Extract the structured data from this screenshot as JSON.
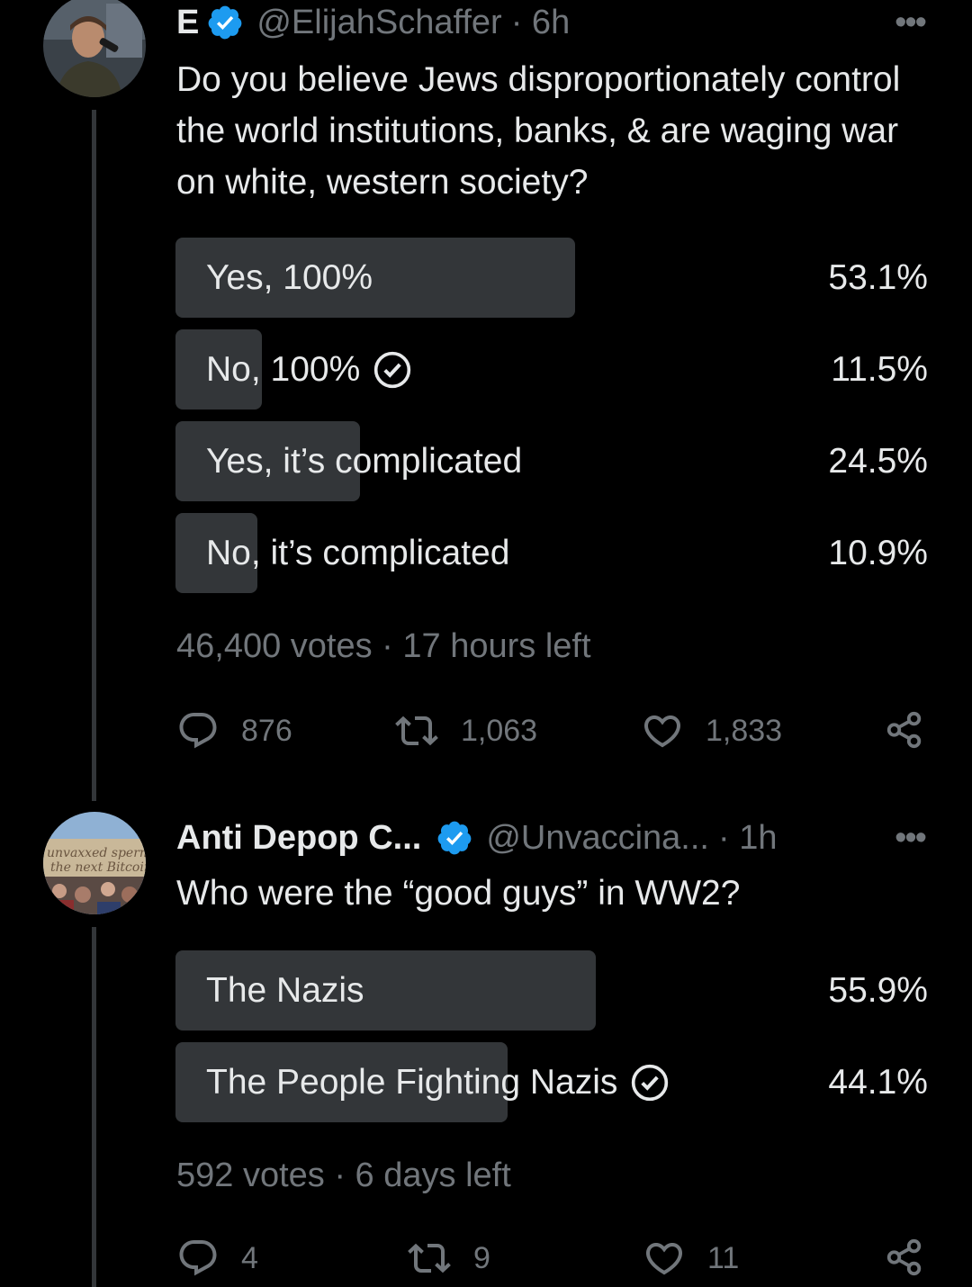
{
  "posts": [
    {
      "name": "E",
      "handle": "@ElijahSchaffer",
      "time": "· 6h",
      "more": "•••",
      "text": "Do you believe Jews disproportionately control the world institutions, banks, & are waging war on white, western society?",
      "poll": {
        "options": [
          {
            "label": "Yes, 100%",
            "percent": "53.1%",
            "fraction": 0.531,
            "selected": false
          },
          {
            "label": "No, 100%",
            "percent": "11.5%",
            "fraction": 0.115,
            "selected": true
          },
          {
            "label": "Yes, it’s complicated",
            "percent": "24.5%",
            "fraction": 0.245,
            "selected": false
          },
          {
            "label": "No, it’s complicated",
            "percent": "10.9%",
            "fraction": 0.109,
            "selected": false
          }
        ],
        "meta": "46,400 votes · 17 hours left"
      },
      "actions": {
        "replies": "876",
        "reposts": "1,063",
        "likes": "1,833"
      }
    },
    {
      "name": "Anti Depop C...",
      "handle": "@Unvaccina...",
      "time": "· 1h",
      "more": "•••",
      "text": "Who were the “good guys” in WW2?",
      "poll": {
        "options": [
          {
            "label": "The Nazis",
            "percent": "55.9%",
            "fraction": 0.559,
            "selected": false
          },
          {
            "label": "The People Fighting Nazis",
            "percent": "44.1%",
            "fraction": 0.441,
            "selected": true
          }
        ],
        "meta": "592 votes · 6 days left"
      },
      "actions": {
        "replies": "4",
        "reposts": "9",
        "likes": "11"
      }
    }
  ],
  "colors": {
    "background": "#000000",
    "bar": "#333639",
    "muted": "#71767b",
    "verified": "#1d9bf0",
    "text": "#e7e9ea"
  }
}
